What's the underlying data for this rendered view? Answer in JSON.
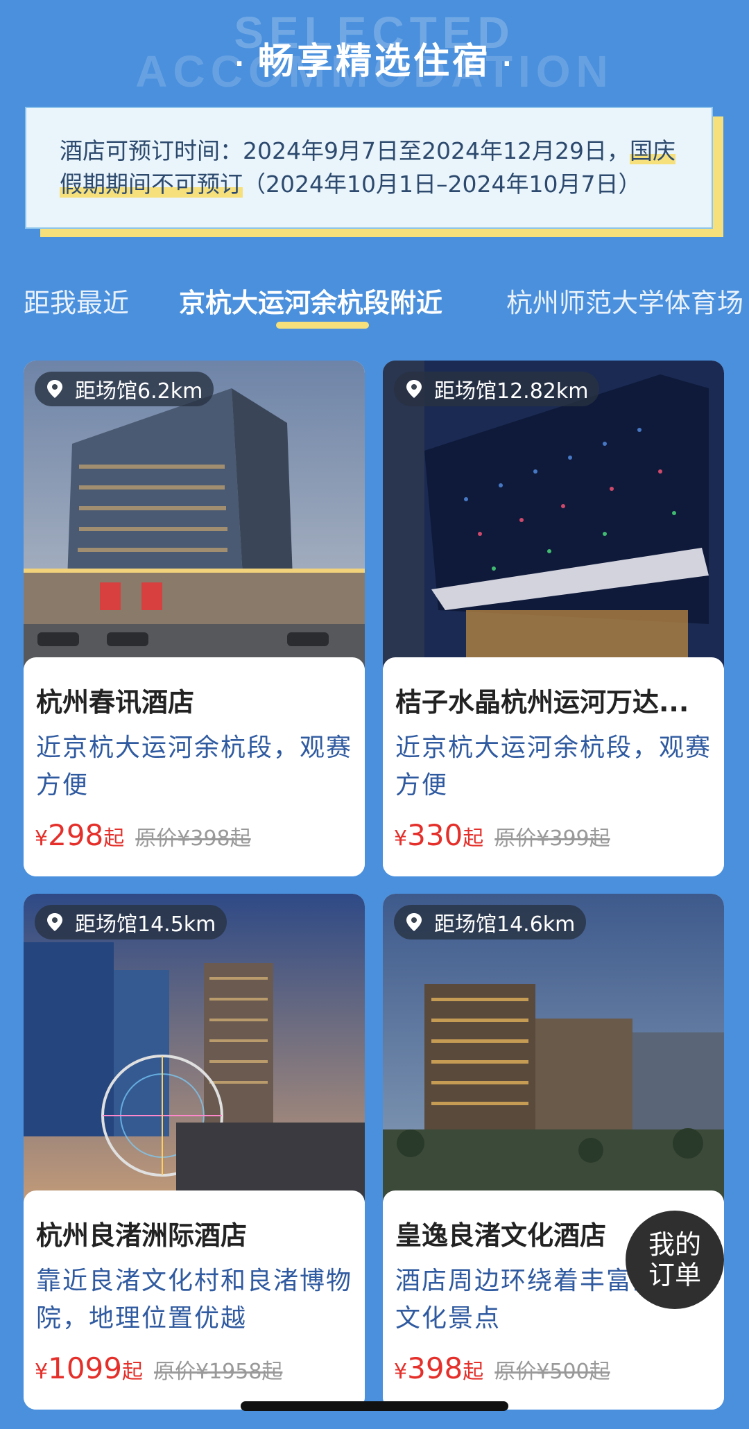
{
  "header": {
    "bg_line1": "SELECTED",
    "bg_line2": "ACCOMMODATION",
    "dot": "·",
    "title": "畅享精选住宿"
  },
  "notice": {
    "text_part1": "酒店可预订时间：2024年9月7日至2024年12月29日，",
    "text_highlight": "国庆假期期间不可预订",
    "text_part2": "（2024年10月1日–2024年10月7日）"
  },
  "tabs": [
    {
      "label": "距我最近",
      "active": false
    },
    {
      "label": "京杭大运河余杭段附近",
      "active": true
    },
    {
      "label": "杭州师范大学体育场",
      "active": false
    }
  ],
  "hotels": [
    {
      "distance": "距场馆6.2km",
      "name": "杭州春讯酒店",
      "desc": "近京杭大运河余杭段，观赛方便",
      "currency": "¥",
      "price": "298",
      "suffix": "起",
      "original": "原价¥398起"
    },
    {
      "distance": "距场馆12.82km",
      "name": "桔子水晶杭州运河万达...",
      "desc": "近京杭大运河余杭段，观赛方便",
      "currency": "¥",
      "price": "330",
      "suffix": "起",
      "original": "原价¥399起"
    },
    {
      "distance": "距场馆14.5km",
      "name": "杭州良渚洲际酒店",
      "desc": "靠近良渚文化村和良渚博物院，地理位置优越",
      "currency": "¥",
      "price": "1099",
      "suffix": "起",
      "original": "原价¥1958起"
    },
    {
      "distance": "距场馆14.6km",
      "name": "皇逸良渚文化酒店",
      "desc": "酒店周边环绕着丰富的历史文化景点",
      "currency": "¥",
      "price": "398",
      "suffix": "起",
      "original": "原价¥500起"
    }
  ],
  "floating_button": {
    "line1": "我的",
    "line2": "订单"
  },
  "colors": {
    "background": "#4a90dd",
    "accent_yellow": "#f6e07c",
    "price_red": "#e42f2a",
    "desc_blue": "#2f5aa0"
  }
}
